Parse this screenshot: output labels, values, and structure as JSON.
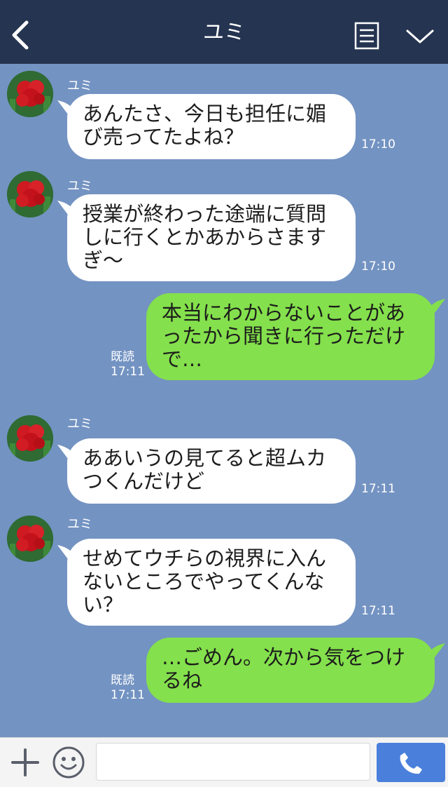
{
  "header": {
    "title": "ユミ"
  },
  "messages": [
    {
      "sender": "ユミ",
      "text": "あんたさ、今日も担任に媚\nび売ってたよね？",
      "time": "17:10"
    },
    {
      "sender": "ユミ",
      "text": "授業が終わった途端に質問\nしに行くとかあからさます\nぎ～",
      "time": "17:10"
    },
    {
      "text": "本当にわからないことがあ\nったから聞きに行っただけ\nで…",
      "read": "既読",
      "time": "17:11"
    },
    {
      "sender": "ユミ",
      "text": "ああいうの見てると超ムカ\nつくんだけど",
      "time": "17:11"
    },
    {
      "sender": "ユミ",
      "text": "せめてウチらの視界に入ん\nないところでやってくんな\nい？",
      "time": "17:11"
    },
    {
      "text": "…ごめん。次から気をつけ\nるね",
      "read": "既読",
      "time": "17:11"
    }
  ],
  "footer": {
    "input_value": ""
  },
  "colors": {
    "header_bg": "#253450",
    "chat_bg": "#7393c2",
    "outgoing_bubble": "#84e04c",
    "incoming_bubble": "#ffffff",
    "call_button": "#4a80dc"
  },
  "icons": [
    "back-arrow-icon",
    "menu-list-icon",
    "chevron-down-icon",
    "plus-icon",
    "emoji-icon",
    "phone-icon"
  ]
}
